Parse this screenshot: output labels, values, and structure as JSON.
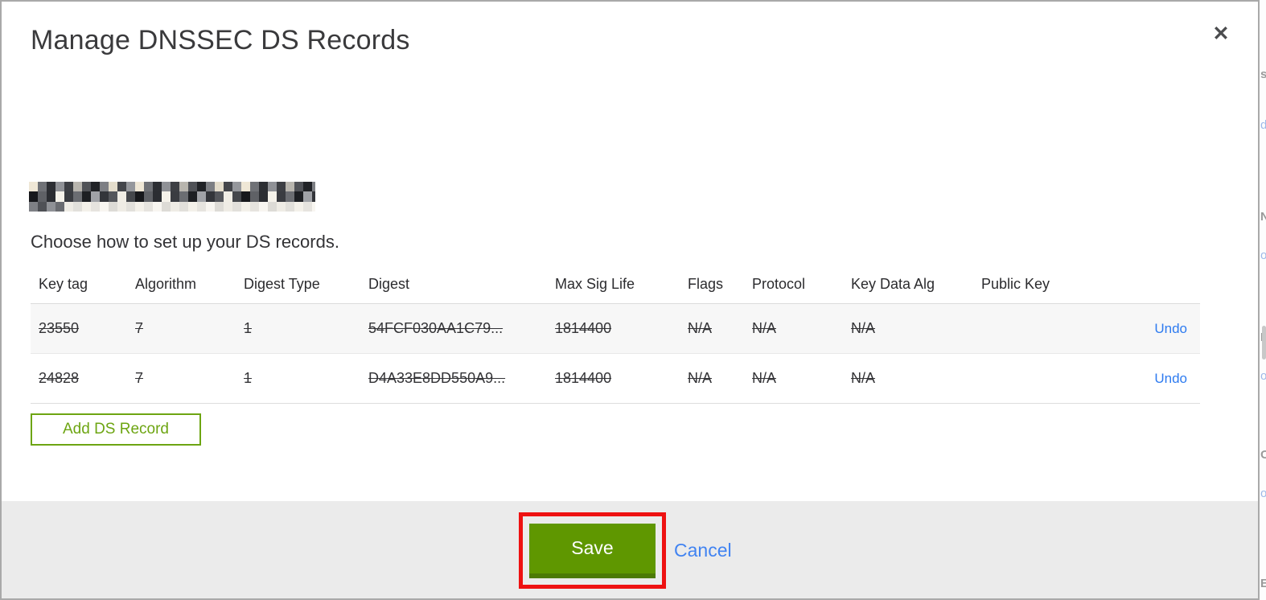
{
  "modal": {
    "title": "Manage DNSSEC DS Records",
    "close_icon": "✕",
    "domain_redacted": true,
    "instruction": "Choose how to set up your DS records.",
    "table": {
      "columns": [
        "Key tag",
        "Algorithm",
        "Digest Type",
        "Digest",
        "Max Sig Life",
        "Flags",
        "Protocol",
        "Key Data Alg",
        "Public Key"
      ],
      "rows": [
        {
          "key_tag": "23550",
          "algorithm": "7",
          "digest_type": "1",
          "digest": "54FCF030AA1C79...",
          "max_sig_life": "1814400",
          "flags": "N/A",
          "protocol": "N/A",
          "key_data_alg": "N/A",
          "public_key": "",
          "action": "Undo",
          "struck": true
        },
        {
          "key_tag": "24828",
          "algorithm": "7",
          "digest_type": "1",
          "digest": "D4A33E8DD550A9...",
          "max_sig_life": "1814400",
          "flags": "N/A",
          "protocol": "N/A",
          "key_data_alg": "N/A",
          "public_key": "",
          "action": "Undo",
          "struck": true
        }
      ]
    },
    "add_button_label": "Add DS Record",
    "footer": {
      "save_label": "Save",
      "cancel_label": "Cancel"
    }
  },
  "backdrop": {
    "fragments": [
      "s",
      "d",
      "N",
      "o",
      "L",
      "o",
      "O",
      "o",
      "E"
    ]
  },
  "colors": {
    "accent_green": "#5f9700",
    "outline_green": "#6da512",
    "link_blue": "#2e7bf0",
    "annotation_red": "#ee1111",
    "footer_gray": "#ebebeb",
    "row_stripe_gray": "#f7f7f7",
    "modal_border_gray": "#a9a9a9"
  }
}
